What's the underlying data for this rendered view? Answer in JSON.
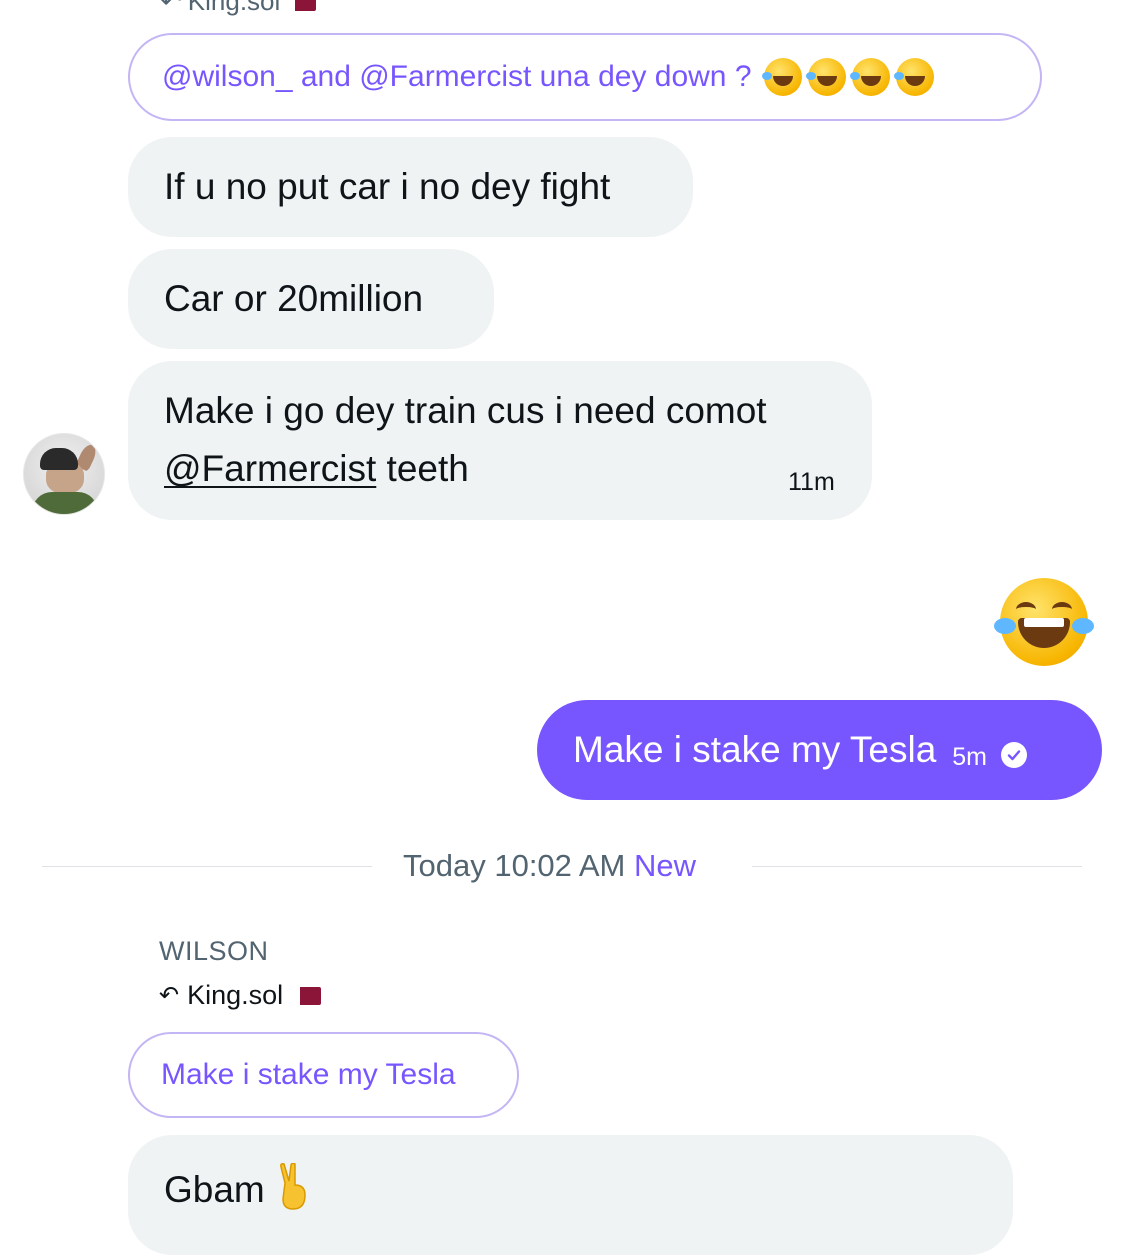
{
  "top_reply": {
    "name": "King.sol"
  },
  "messages": {
    "reply_quote_1": "@wilson_ and @Farmercist una dey down ?",
    "msg_1": "If u no put car i no dey fight",
    "msg_2": "Car or 20million",
    "msg_3_line1": "Make i go dey train cus i need comot",
    "msg_3_mention": "@Farmercist",
    "msg_3_rest": " teeth",
    "msg_3_time": "11m",
    "sent_msg": "Make i stake my Tesla",
    "sent_time": "5m"
  },
  "divider": {
    "text": "Today 10:02 AM",
    "new_label": "New"
  },
  "new_message": {
    "sender": "WILSON",
    "reply_to": "King.sol",
    "quote": "Make i stake my Tesla",
    "text": "Gbam"
  },
  "colors": {
    "accent": "#7856ff",
    "bubble_in": "#eff3f4",
    "muted": "#536471"
  },
  "icons": {
    "reply": "reply-arrow-icon",
    "flag": "qatar-flag-icon",
    "check": "sent-check-icon",
    "laugh": "rolling-laughing-emoji",
    "joy": "tears-of-joy-emoji",
    "victory": "victory-hand-emoji"
  }
}
